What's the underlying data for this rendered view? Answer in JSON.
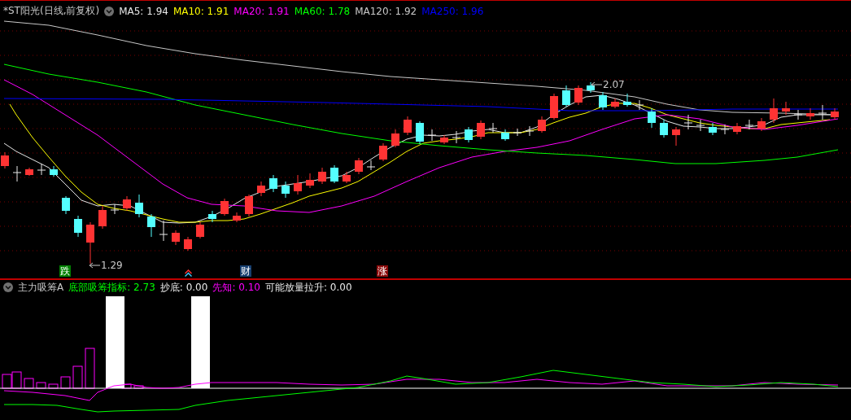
{
  "main_panel": {
    "title": "*ST阳光(日线,前复权)",
    "indicators": [
      {
        "label": "MA5: 1.94",
        "color": "#e8e8e8"
      },
      {
        "label": "MA10: 1.91",
        "color": "#ffff00"
      },
      {
        "label": "MA20: 1.91",
        "color": "#ff00ff"
      },
      {
        "label": "MA60: 1.78",
        "color": "#00ff00"
      },
      {
        "label": "MA120: 1.92",
        "color": "#c8c8c8"
      },
      {
        "label": "MA250: 1.96",
        "color": "#0000ff"
      }
    ],
    "annotations": [
      {
        "kind": "high",
        "text": "2.07"
      },
      {
        "kind": "low",
        "text": "1.29"
      }
    ],
    "badges": [
      {
        "text": "跌",
        "color": "#008000"
      },
      {
        "text": "财",
        "color": "#163e6e"
      },
      {
        "text": "涨",
        "color": "#8b0a0a"
      }
    ]
  },
  "sub_panel": {
    "title": "主力吸筹A",
    "indicators": [
      {
        "label": "底部吸筹指标: 2.73",
        "color": "#00ff00"
      },
      {
        "label": "抄底: 0.00",
        "color": "#e8e8e8"
      },
      {
        "label": "先知: 0.10",
        "color": "#ff00ff"
      },
      {
        "label": "可能放量拉升: 0.00",
        "color": "#e8e8e8"
      }
    ]
  }
}
